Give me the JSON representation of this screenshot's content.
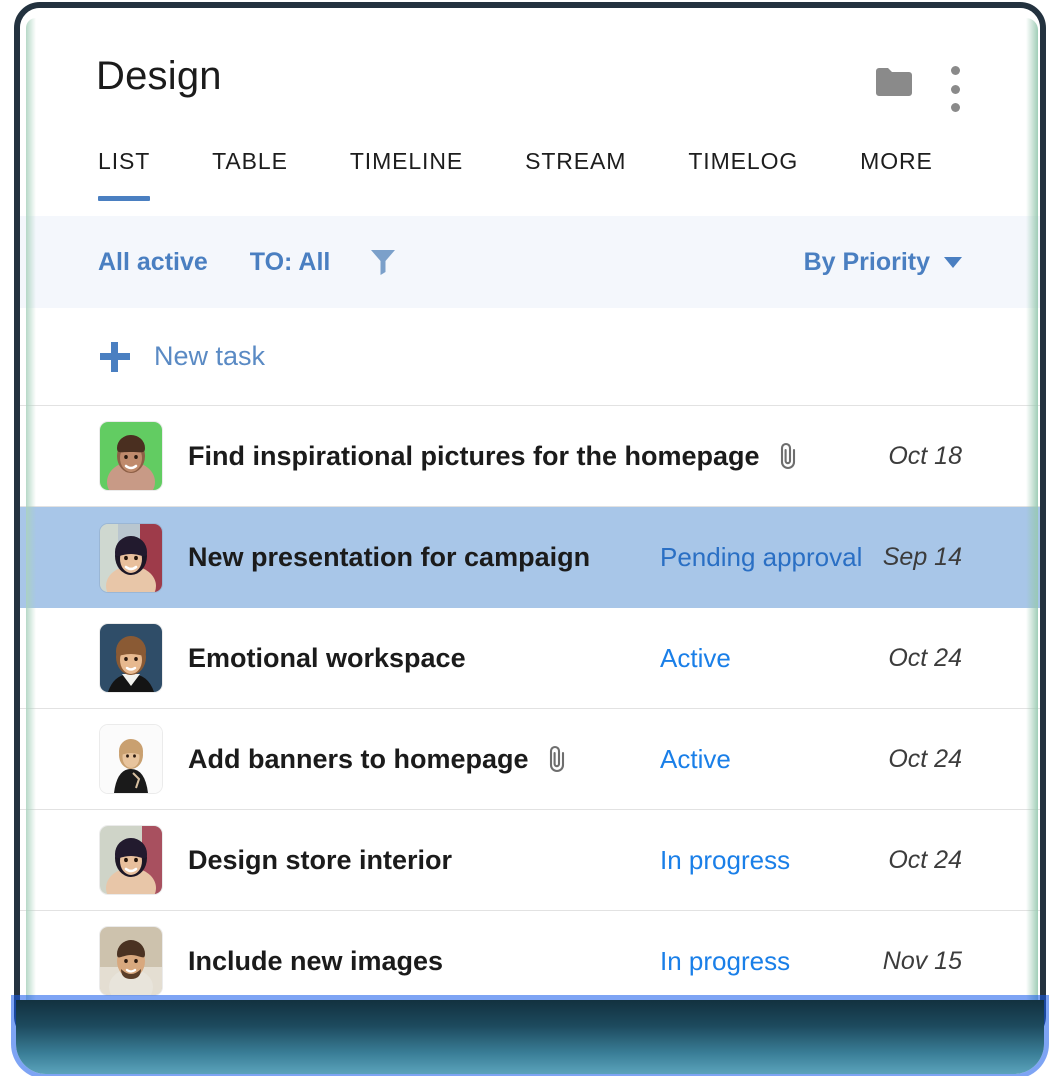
{
  "header": {
    "title": "Design",
    "folder_icon": "folder-icon",
    "menu_icon": "kebab-menu-icon"
  },
  "tabs": [
    {
      "label": "LIST",
      "active": true
    },
    {
      "label": "TABLE",
      "active": false
    },
    {
      "label": "TIMELINE",
      "active": false
    },
    {
      "label": "STREAM",
      "active": false
    },
    {
      "label": "TIMELOG",
      "active": false
    },
    {
      "label": "MORE",
      "active": false
    }
  ],
  "filter_bar": {
    "all_active_label": "All active",
    "to_label": "TO: All",
    "funnel_icon": "filter-funnel-icon",
    "sort_label": "By Priority",
    "sort_caret_icon": "chevron-down-icon"
  },
  "new_task": {
    "label": "New task",
    "plus_icon": "plus-icon"
  },
  "tasks": [
    {
      "title": "Find inspirational pictures for the homepage",
      "status": "",
      "date": "Oct 18",
      "has_attachment": true,
      "selected": false,
      "avatar_name": "avatar-green-background"
    },
    {
      "title": "New presentation for campaign",
      "status": "Pending approval",
      "date": "Sep 14",
      "has_attachment": false,
      "selected": true,
      "avatar_name": "avatar-dark-hair-woman"
    },
    {
      "title": "Emotional workspace",
      "status": "Active",
      "date": "Oct 24",
      "has_attachment": false,
      "selected": false,
      "avatar_name": "avatar-blue-background-woman"
    },
    {
      "title": "Add banners to homepage",
      "status": "Active",
      "date": "Oct 24",
      "has_attachment": true,
      "selected": false,
      "avatar_name": "avatar-white-background-woman"
    },
    {
      "title": "Design store interior",
      "status": "In progress",
      "date": "Oct 24",
      "has_attachment": false,
      "selected": false,
      "avatar_name": "avatar-dark-hair-woman-2"
    },
    {
      "title": "Include new images",
      "status": "In progress",
      "date": "Nov 15",
      "has_attachment": false,
      "selected": false,
      "avatar_name": "avatar-bearded-man"
    }
  ],
  "colors": {
    "accent_blue": "#4a7fc1",
    "status_blue": "#1a7fe8",
    "selected_row": "#a8c6e8",
    "filter_bar_bg": "#f4f7fc",
    "frame": "#23323f",
    "icon_gray": "#8a8a8a"
  }
}
